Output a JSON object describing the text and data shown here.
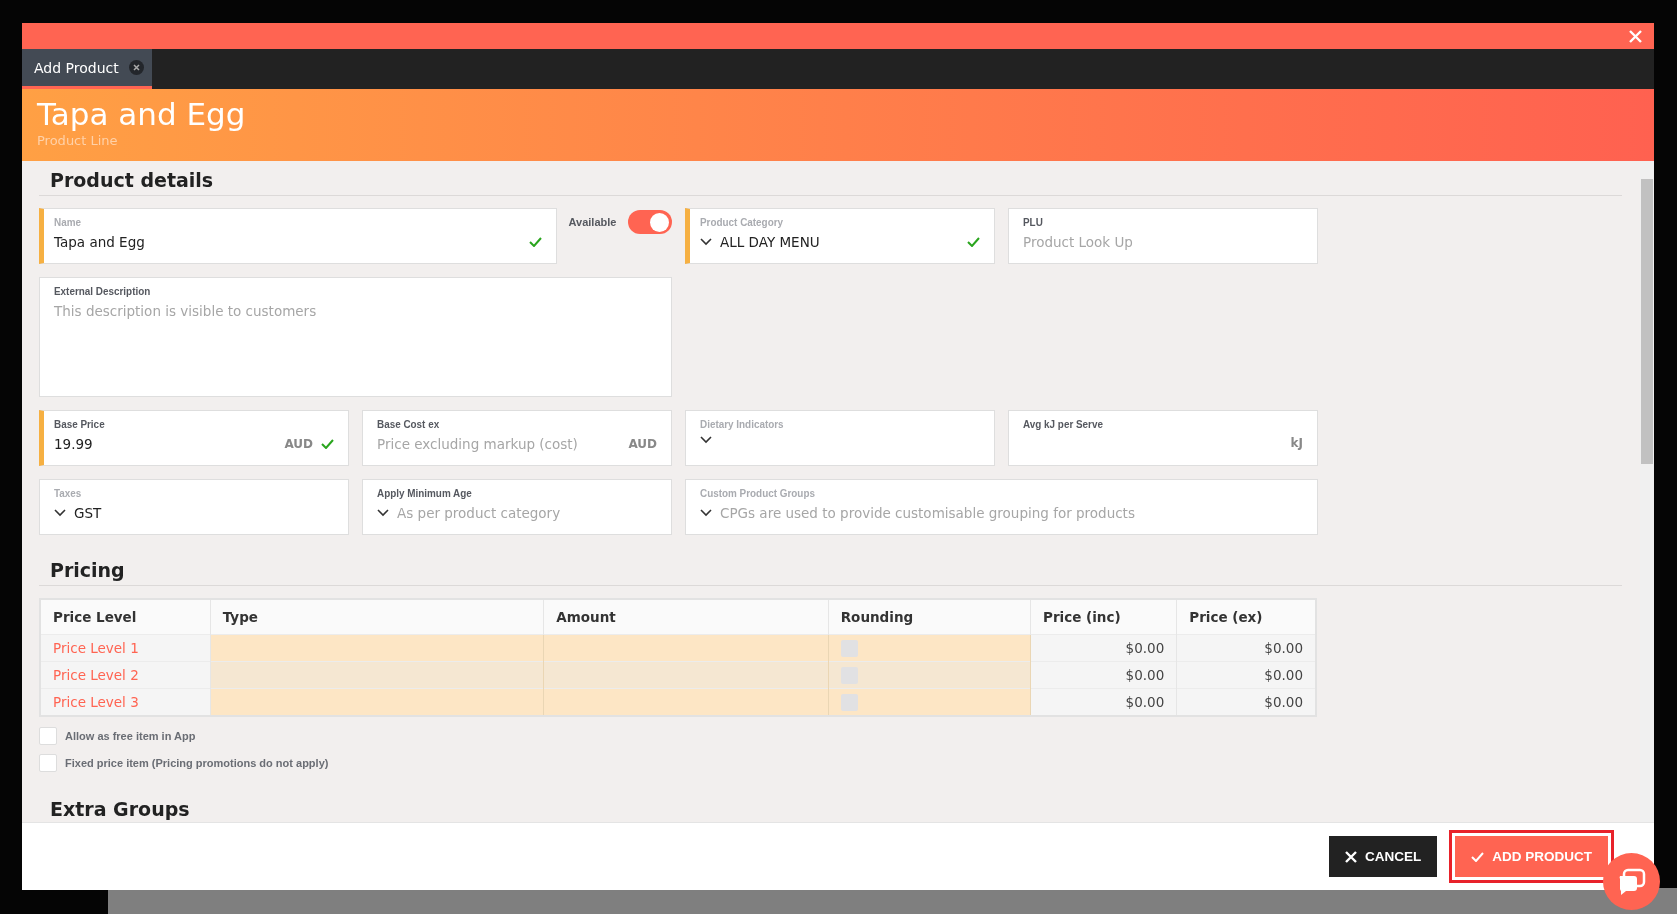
{
  "tab": {
    "label": "Add Product",
    "selected": true
  },
  "header": {
    "title": "Tapa and Egg",
    "subtitle": "Product Line"
  },
  "sections": {
    "details": "Product details",
    "pricing": "Pricing",
    "extra": "Extra Groups"
  },
  "available": {
    "label": "Available",
    "on": true
  },
  "fields": [
    {
      "kind": "text",
      "label": "Name",
      "value": "Tapa and Egg",
      "required": true,
      "valid": true,
      "label_muted": true
    },
    {
      "kind": "select",
      "label": "Product Category",
      "value": "ALL DAY MENU",
      "required": true,
      "valid": true,
      "label_muted": true
    },
    {
      "kind": "text",
      "label": "PLU",
      "placeholder": "Product Look Up",
      "required": false,
      "valid": false,
      "label_muted": false
    },
    {
      "kind": "textarea",
      "label": "External Description",
      "placeholder": "This description is visible to customers",
      "required": false,
      "valid": false,
      "label_muted": false
    },
    {
      "kind": "text",
      "label": "Base Price",
      "value": "19.99",
      "unit": "AUD",
      "required": true,
      "valid": true,
      "label_muted": false
    },
    {
      "kind": "text",
      "label": "Base Cost ex",
      "placeholder": "Price excluding markup (cost)",
      "unit": "AUD",
      "required": false,
      "valid": false,
      "label_muted": false
    },
    {
      "kind": "select",
      "label": "Dietary Indicators",
      "required": false,
      "valid": false,
      "label_muted": true
    },
    {
      "kind": "text",
      "label": "Avg kJ per Serve",
      "unit": "kJ",
      "required": false,
      "valid": false,
      "label_muted": false
    },
    {
      "kind": "select",
      "label": "Taxes",
      "value": "GST",
      "required": false,
      "valid": false,
      "label_muted": true
    },
    {
      "kind": "select",
      "label": "Apply Minimum Age",
      "placeholder": "As per product category",
      "required": false,
      "valid": false,
      "label_muted": false
    },
    {
      "kind": "select",
      "label": "Custom Product Groups",
      "placeholder": "CPGs are used to provide customisable grouping for products",
      "required": false,
      "valid": false,
      "label_muted": true
    }
  ],
  "pricing": {
    "columns": [
      "Price Level",
      "Type",
      "Amount",
      "Rounding",
      "Price (inc)",
      "Price (ex)"
    ],
    "rows": [
      {
        "level": "Price Level 1",
        "rounding": false,
        "price_inc": "$0.00",
        "price_ex": "$0.00"
      },
      {
        "level": "Price Level 2",
        "rounding": false,
        "price_inc": "$0.00",
        "price_ex": "$0.00"
      },
      {
        "level": "Price Level 3",
        "rounding": false,
        "price_inc": "$0.00",
        "price_ex": "$0.00"
      }
    ]
  },
  "options": [
    {
      "label": "Allow as free item in App",
      "checked": false
    },
    {
      "label": "Fixed price item (Pricing promotions do not apply)",
      "checked": false
    }
  ],
  "footer": {
    "cancel": "CANCEL",
    "confirm": "ADD PRODUCT",
    "confirm_highlighted": true
  }
}
